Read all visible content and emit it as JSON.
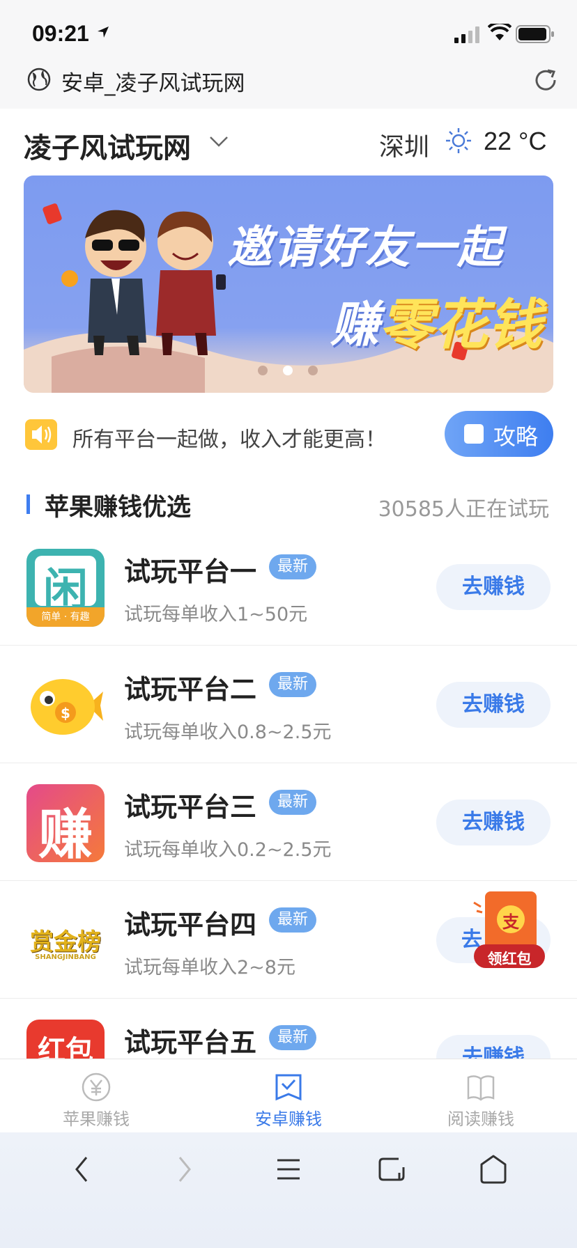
{
  "status": {
    "time": "09:21"
  },
  "browser": {
    "url_title": "安卓_凌子风试玩网"
  },
  "header": {
    "site_name": "凌子风试玩网",
    "city": "深圳",
    "temperature": "22 °C"
  },
  "banner": {
    "line1": "邀请好友一起",
    "line2a": "赚",
    "line2b": "零花钱",
    "slide_count": 3,
    "active_slide": 2
  },
  "notice": {
    "text": "所有平台一起做，收入才能更高！",
    "guide_button": "攻略"
  },
  "section": {
    "title": "苹果赚钱优选",
    "count": "30585人正在试玩"
  },
  "apps": [
    {
      "name": "试玩平台一",
      "badge": "最新",
      "desc": "试玩每单收入1~50元",
      "button": "去赚钱",
      "icon": "xian-app-icon"
    },
    {
      "name": "试玩平台二",
      "badge": "最新",
      "desc": "试玩每单收入0.8~2.5元",
      "button": "去赚钱",
      "icon": "goldfish-app-icon"
    },
    {
      "name": "试玩平台三",
      "badge": "最新",
      "desc": "试玩每单收入0.2~2.5元",
      "button": "去赚钱",
      "icon": "zhuan-app-icon"
    },
    {
      "name": "试玩平台四",
      "badge": "最新",
      "desc": "试玩每单收入2~8元",
      "button": "去",
      "icon": "shangjinbang-app-icon"
    },
    {
      "name": "试玩平台五",
      "badge": "最新",
      "desc": "",
      "button": "去赚钱",
      "icon": "hongbao-app-icon"
    }
  ],
  "app_icon_text": {
    "xian": "闲",
    "xian_sub": "简单 · 有趣",
    "zhuan": "赚",
    "shangjin": "赏金榜",
    "shangjin_sub": "SHANGJINBANG",
    "hongbao": "红包"
  },
  "floating": {
    "label": "领红包",
    "glyph": "支"
  },
  "tabs": [
    {
      "label": "苹果赚钱",
      "icon": "yen-icon",
      "active": false
    },
    {
      "label": "安卓赚钱",
      "icon": "check-square-icon",
      "active": true
    },
    {
      "label": "阅读赚钱",
      "icon": "book-icon",
      "active": false
    }
  ],
  "colors": {
    "accent": "#3a7ae8",
    "badge": "#6ea8ee",
    "muted": "#8a8a8a"
  }
}
